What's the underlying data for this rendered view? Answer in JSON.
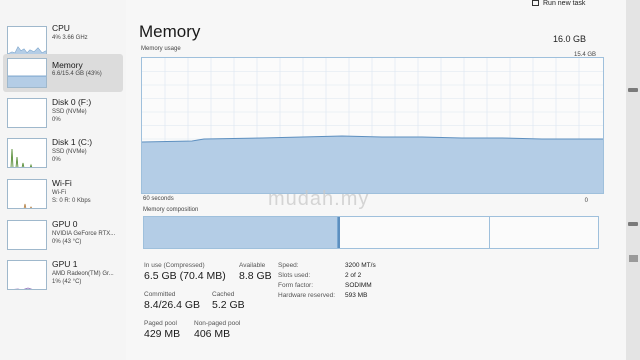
{
  "top": {
    "run_task": "Run new task"
  },
  "sidebar": {
    "items": [
      {
        "title": "CPU",
        "sub1": "4% 3.66 GHz",
        "sub2": "",
        "sub3": ""
      },
      {
        "title": "Memory",
        "sub1": "6.6/15.4 GB (43%)",
        "sub2": "",
        "sub3": ""
      },
      {
        "title": "Disk 0 (F:)",
        "sub1": "SSD (NVMe)",
        "sub2": "0%",
        "sub3": ""
      },
      {
        "title": "Disk 1 (C:)",
        "sub1": "SSD (NVMe)",
        "sub2": "0%",
        "sub3": ""
      },
      {
        "title": "Wi-Fi",
        "sub1": "Wi-Fi",
        "sub2": "S: 0 R: 0 Kbps",
        "sub3": ""
      },
      {
        "title": "GPU 0",
        "sub1": "NVIDIA GeForce RTX...",
        "sub2": "0% (43 °C)",
        "sub3": ""
      },
      {
        "title": "GPU 1",
        "sub1": "AMD Radeon(TM) Gr...",
        "sub2": "1% (42 °C)",
        "sub3": ""
      }
    ]
  },
  "main": {
    "title": "Memory",
    "total": "16.0 GB",
    "usage_label": "Memory usage",
    "usage_max": "15.4 GB",
    "seconds_label": "60 seconds",
    "zero_label": "0",
    "composition_label": "Memory composition",
    "usage_fraction": 0.43,
    "stats": {
      "in_use_label": "In use (Compressed)",
      "in_use": "6.5 GB (70.4 MB)",
      "available_label": "Available",
      "available": "8.8 GB",
      "committed_label": "Committed",
      "committed": "8.4/26.4 GB",
      "cached_label": "Cached",
      "cached": "5.2 GB",
      "paged_label": "Paged pool",
      "paged": "429 MB",
      "nonpaged_label": "Non-paged pool",
      "nonpaged": "406 MB"
    },
    "info": [
      {
        "k": "Speed:",
        "v": "3200 MT/s"
      },
      {
        "k": "Slots used:",
        "v": "2 of 2"
      },
      {
        "k": "Form factor:",
        "v": "SODIMM"
      },
      {
        "k": "Hardware reserved:",
        "v": "593 MB"
      }
    ]
  },
  "watermark": "mudah.my",
  "colors": {
    "accent": "#9fc0dc",
    "fill": "#b4cde6",
    "line": "#5d8fbf"
  }
}
